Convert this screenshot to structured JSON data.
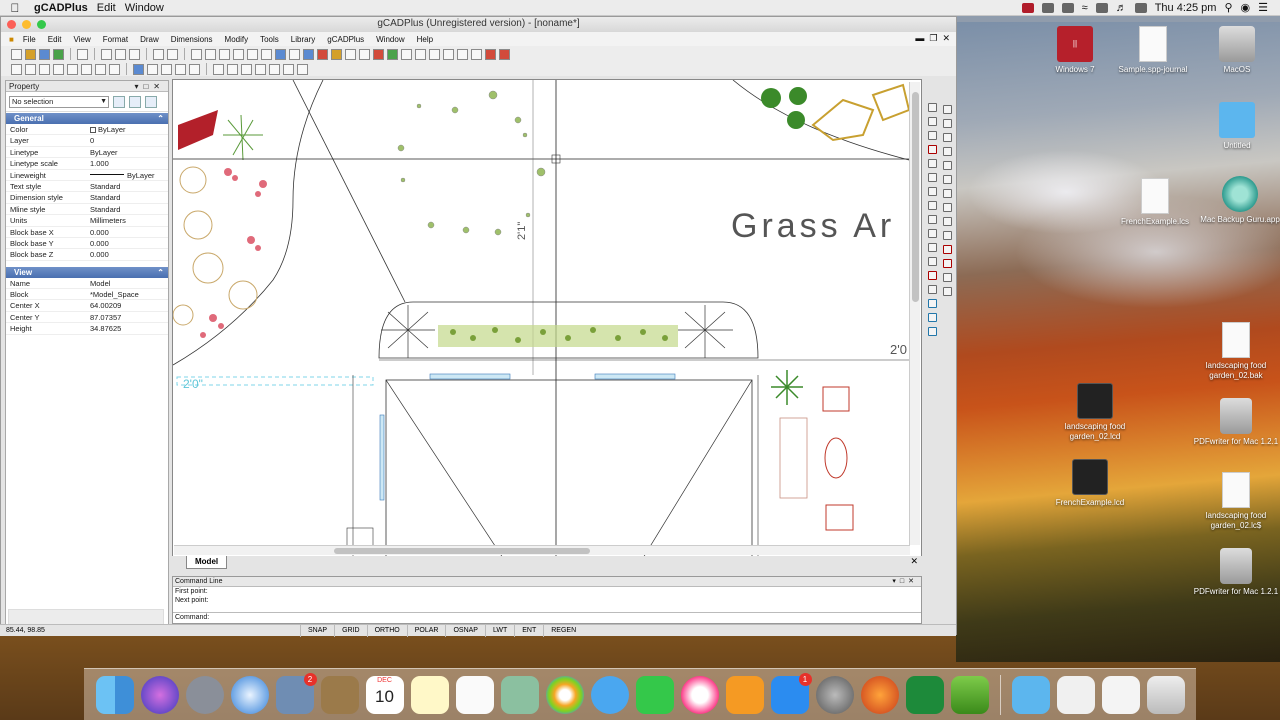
{
  "menubar": {
    "app_name": "gCADPlus",
    "items": [
      "Edit",
      "Window"
    ],
    "clock": "Thu 4:25 pm"
  },
  "window": {
    "title": "gCADPlus (Unregistered version) - [noname*]",
    "menu": [
      "File",
      "Edit",
      "View",
      "Format",
      "Draw",
      "Dimensions",
      "Modify",
      "Tools",
      "Library",
      "gCADPlus",
      "Window",
      "Help"
    ]
  },
  "property_panel": {
    "title": "Property",
    "selection": "No selection",
    "general_header": "General",
    "general": [
      {
        "key": "Color",
        "value": "ByLayer"
      },
      {
        "key": "Layer",
        "value": "0"
      },
      {
        "key": "Linetype",
        "value": "ByLayer"
      },
      {
        "key": "Linetype scale",
        "value": "1.000"
      },
      {
        "key": "Lineweight",
        "value": "ByLayer"
      },
      {
        "key": "Text style",
        "value": "Standard"
      },
      {
        "key": "Dimension style",
        "value": "Standard"
      },
      {
        "key": "Mline style",
        "value": "Standard"
      },
      {
        "key": "Units",
        "value": "Millimeters"
      },
      {
        "key": "Block base X",
        "value": "0.000"
      },
      {
        "key": "Block base Y",
        "value": "0.000"
      },
      {
        "key": "Block base Z",
        "value": "0.000"
      }
    ],
    "view_header": "View",
    "view": [
      {
        "key": "Name",
        "value": "Model"
      },
      {
        "key": "Block",
        "value": "*Model_Space"
      },
      {
        "key": "Center X",
        "value": "64.00209"
      },
      {
        "key": "Center Y",
        "value": "87.07357"
      },
      {
        "key": "Height",
        "value": "34.87625"
      }
    ]
  },
  "canvas": {
    "grass_label": "Grass Ar",
    "dim_left": "2'0\"",
    "dim_right": "2'0",
    "dim_vertical": "2'1\"",
    "model_tab": "Model"
  },
  "command": {
    "title": "Command Line",
    "lines": [
      "First point:",
      "Next point:"
    ],
    "prompt": "Command:"
  },
  "status": {
    "coords": "85.44, 98.85",
    "toggles": [
      "SNAP",
      "GRID",
      "ORTHO",
      "POLAR",
      "OSNAP",
      "LWT",
      "ENT",
      "REGEN"
    ]
  },
  "desktop_icons": [
    {
      "label": "Windows 7"
    },
    {
      "label": "Sample.spp-journal"
    },
    {
      "label": "MacOS"
    },
    {
      "label": "Untitled"
    },
    {
      "label": "FrenchExample.lcs"
    },
    {
      "label": "Mac Backup Guru.app"
    },
    {
      "label": "landscaping food garden_02.bak"
    },
    {
      "label": "landscaping food garden_02.lcd"
    },
    {
      "label": "PDFwriter for Mac 1.2.1"
    },
    {
      "label": "FrenchExample.lcd"
    },
    {
      "label": "landscaping food garden_02.lc$"
    },
    {
      "label": "PDFwriter for Mac 1.2.1"
    }
  ],
  "dock": {
    "calendar_month": "DEC",
    "calendar_day": "10",
    "badges": {
      "mail": "2",
      "appstore": "1"
    }
  }
}
